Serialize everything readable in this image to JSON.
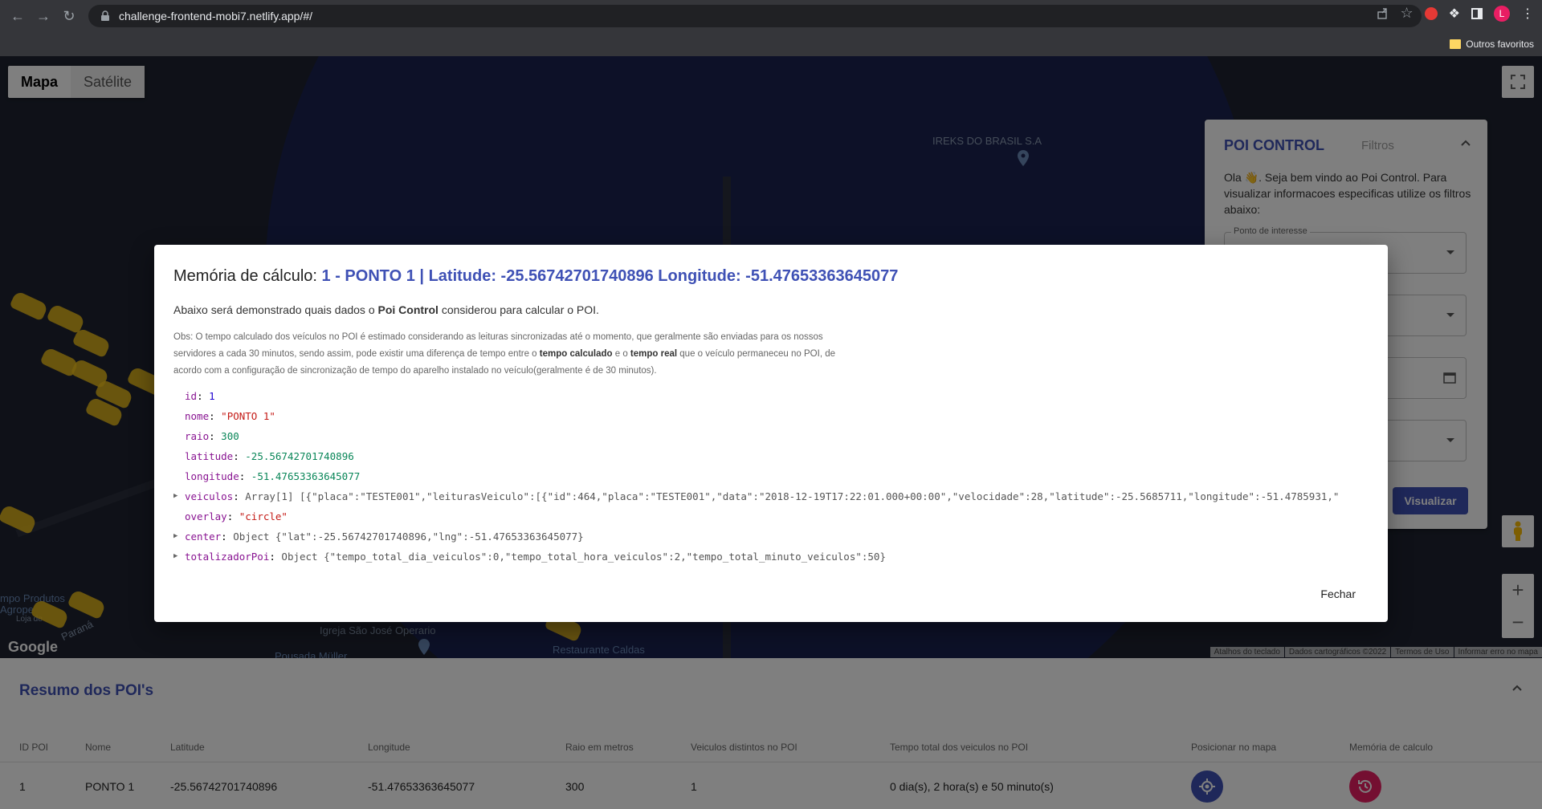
{
  "browser": {
    "url": "challenge-frontend-mobi7.netlify.app/#/",
    "bookmark_folder": "Outros favoritos",
    "avatar_letter": "L"
  },
  "map": {
    "type_map": "Mapa",
    "type_satellite": "Satélite",
    "labels": {
      "ireks": "IREKS DO BRASIL S.A",
      "igreja": "Igreja São José Operario",
      "restaurante": "Restaurante Caldas",
      "produtos": "mpo Produtos",
      "agrope": "Agrope",
      "loja": "Loja de",
      "parana": "Paraná",
      "pousada": "Pousada Müller"
    },
    "google": "Google",
    "footer": [
      "Atalhos do teclado",
      "Dados cartográficos ©2022",
      "Termos de Uso",
      "Informar erro no mapa"
    ]
  },
  "poi_panel": {
    "title": "POI CONTROL",
    "filters_tab": "Filtros",
    "welcome": "Ola 👋. Seja bem vindo ao Poi Control. Para visualizar informacoes especificas utilize os filtros abaixo:",
    "field_label": "Ponto de interesse",
    "button": "Visualizar"
  },
  "dialog": {
    "title_prefix": "Memória de cálculo:",
    "title_accent": "1 - PONTO 1 | Latitude: -25.56742701740896 Longitude: -51.47653363645077",
    "subtitle_pre": "Abaixo será demonstrado quais dados o ",
    "subtitle_bold": "Poi Control",
    "subtitle_post": " considerou para calcular o POI.",
    "obs_1": "Obs: O tempo calculado dos veículos no POI é estimado considerando as leituras sincronizadas até o momento, que geralmente são enviadas para os nossos servidores a cada 30 minutos, sendo assim, pode existir uma diferença de tempo entre o ",
    "obs_b1": "tempo calculado",
    "obs_2": " e o ",
    "obs_b2": "tempo real",
    "obs_3": " que o veículo permaneceu no POI, de acordo com a configuração de sincronização de tempo do aparelho instalado no veículo(geralmente é de 30 minutos).",
    "json": {
      "id_key": "id",
      "id_val": "1",
      "nome_key": "nome",
      "nome_val": "\"PONTO 1\"",
      "raio_key": "raio",
      "raio_val": "300",
      "lat_key": "latitude",
      "lat_val": "-25.56742701740896",
      "lng_key": "longitude",
      "lng_val": "-51.47653363645077",
      "veic_key": "veiculos",
      "veic_val": "Array[1] [{\"placa\":\"TESTE001\",\"leiturasVeiculo\":[{\"id\":464,\"placa\":\"TESTE001\",\"data\":\"2018-12-19T17:22:01.000+00:00\",\"velocidade\":28,\"latitude\":-25.5685711,\"longitude\":-51.4785931,\"",
      "overlay_key": "overlay",
      "overlay_val": "\"circle\"",
      "center_key": "center",
      "center_val": "Object {\"lat\":-25.56742701740896,\"lng\":-51.47653363645077}",
      "tot_key": "totalizadorPoi",
      "tot_val": "Object {\"tempo_total_dia_veiculos\":0,\"tempo_total_hora_veiculos\":2,\"tempo_total_minuto_veiculos\":50}"
    },
    "close": "Fechar"
  },
  "summary": {
    "title": "Resumo dos POI's",
    "headers": [
      "ID POI",
      "Nome",
      "Latitude",
      "Longitude",
      "Raio em metros",
      "Veiculos distintos no POI",
      "Tempo total dos veiculos no POI",
      "Posicionar no mapa",
      "Memória de calculo"
    ],
    "row": [
      "1",
      "PONTO 1",
      "-25.56742701740896",
      "-51.47653363645077",
      "300",
      "1",
      "0 dia(s), 2 hora(s) e 50 minuto(s)"
    ]
  },
  "colors": {
    "accent": "#3f51b5",
    "history": "#e91e63"
  }
}
